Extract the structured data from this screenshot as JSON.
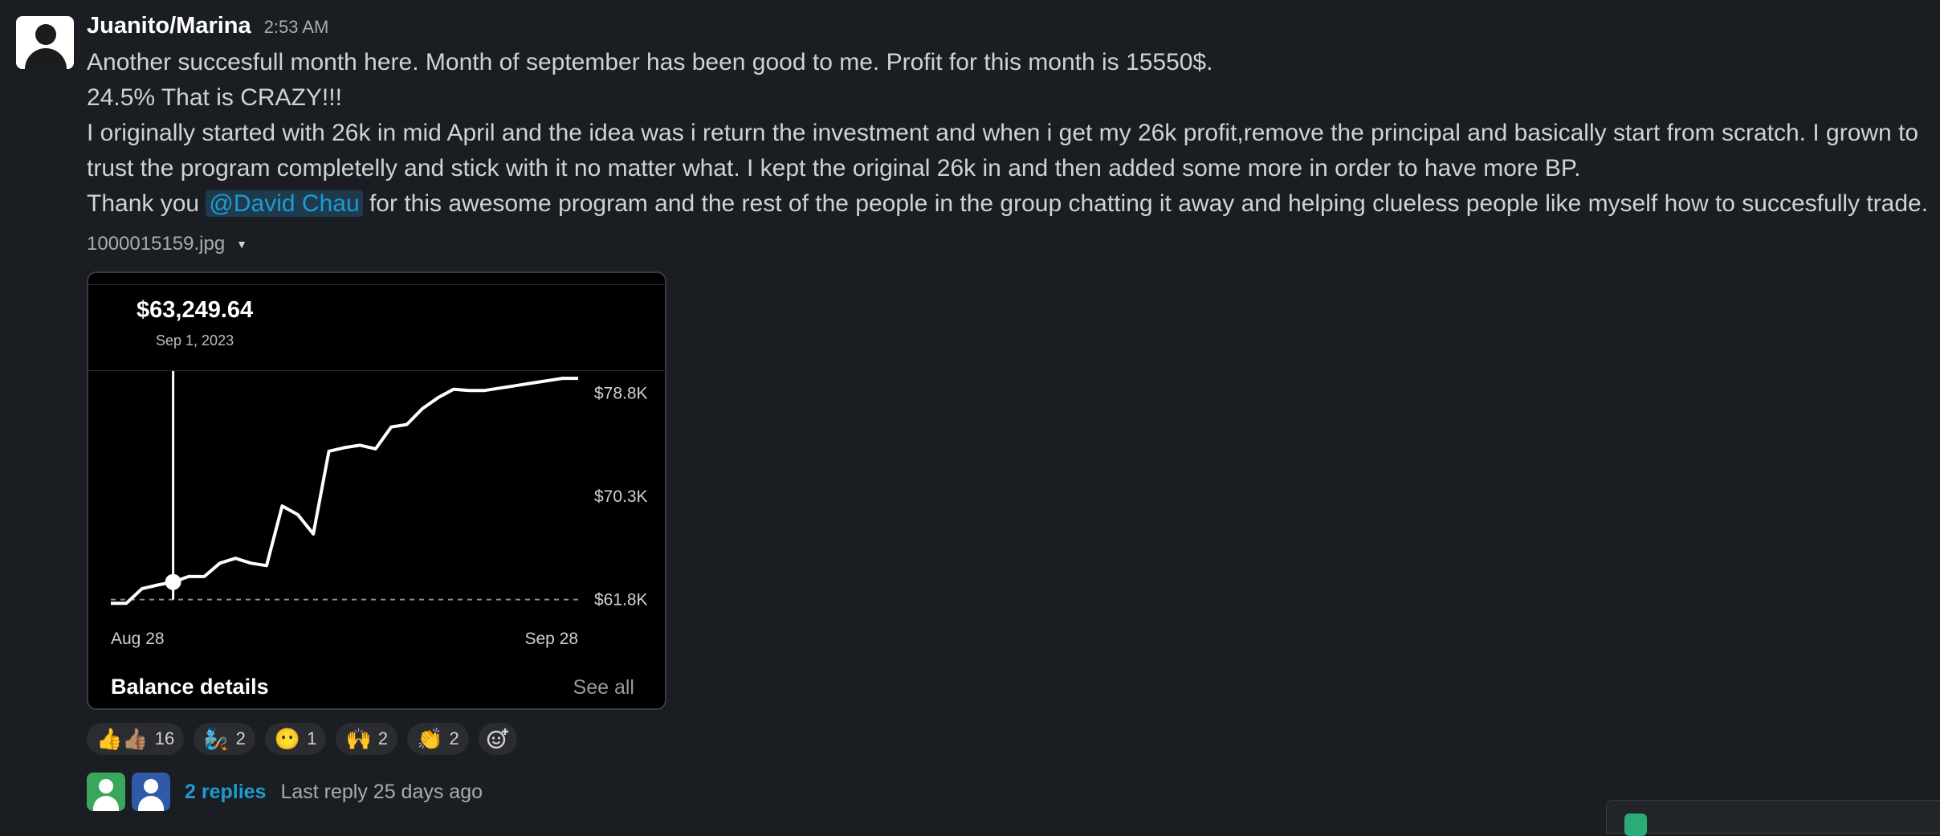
{
  "message": {
    "author": "Juanito/Marina",
    "timestamp": "2:53 AM",
    "line1": "Another succesfull month here. Month of september has been good to me. Profit for this month is 15550$.",
    "line2": "24.5% That is CRAZY!!!",
    "line3": "I originally started with 26k in mid April and the idea was i return the investment and when i get my 26k profit,remove the principal and basically start from scratch. I grown to",
    "line4": "trust the program completelly and stick with it no matter what. I kept the original 26k in and then added some more in order to have more BP.",
    "line5_before": "Thank you ",
    "mention": "@David Chau",
    "line5_after": " for this awesome program and the rest of the people in the group chatting it away and helping clueless people like myself how to succesfully trade."
  },
  "attachment": {
    "filename": "1000015159.jpg",
    "price": "$63,249.64",
    "price_date": "Sep 1, 2023",
    "footer_label": "Balance details",
    "see_all": "See all"
  },
  "chart_data": {
    "type": "line",
    "x_start_label": "Aug 28",
    "x_end_label": "Sep 28",
    "y_tick_labels": [
      "$78.8K",
      "$70.3K",
      "$61.8K"
    ],
    "y_ticks": [
      78.8,
      70.3,
      61.8
    ],
    "ylim": [
      59.6,
      80.6
    ],
    "baseline": 61.8,
    "selected_point": {
      "x": 4,
      "y": 63.25,
      "label": "Sep 1, 2023"
    },
    "x": [
      0,
      1,
      2,
      3,
      4,
      5,
      6,
      7,
      8,
      9,
      10,
      11,
      12,
      13,
      14,
      15,
      16,
      17,
      18,
      19,
      20,
      21,
      22,
      23,
      24,
      25,
      26,
      27,
      28,
      29,
      30
    ],
    "values": [
      61.5,
      61.5,
      62.7,
      63.0,
      63.25,
      63.7,
      63.7,
      64.8,
      65.2,
      64.8,
      64.6,
      69.5,
      68.8,
      67.2,
      74.0,
      74.3,
      74.5,
      74.2,
      76.0,
      76.2,
      77.5,
      78.4,
      79.1,
      79.0,
      79.0,
      79.2,
      79.4,
      79.6,
      79.8,
      80.0,
      80.0
    ]
  },
  "reactions": [
    {
      "emoji": "👍👍🏽",
      "count": "16"
    },
    {
      "emoji": "🧞",
      "count": "2"
    },
    {
      "emoji": "😶",
      "count": "1"
    },
    {
      "emoji": "🙌",
      "count": "2"
    },
    {
      "emoji": "👏",
      "count": "2"
    }
  ],
  "thread": {
    "replies": "2 replies",
    "last_reply": "Last reply 25 days ago"
  },
  "colors": {
    "background": "#1a1d21",
    "link": "#1d9bd1",
    "avatar_green": "#3aa55d",
    "avatar_blue": "#2e5aa8"
  }
}
